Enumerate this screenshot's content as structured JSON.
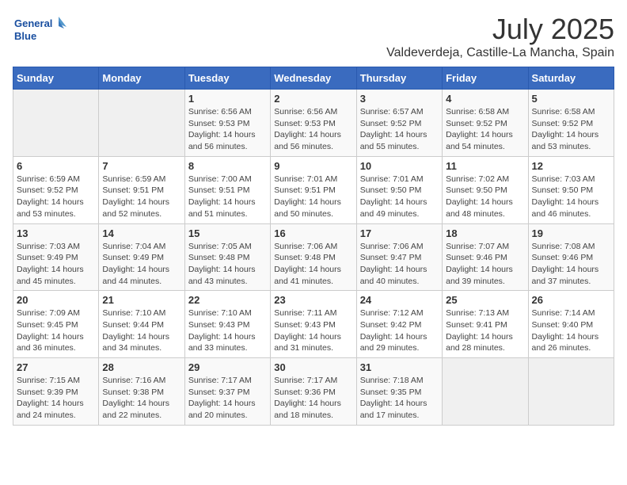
{
  "header": {
    "logo_line1": "General",
    "logo_line2": "Blue",
    "month": "July 2025",
    "location": "Valdeverdeja, Castille-La Mancha, Spain"
  },
  "weekdays": [
    "Sunday",
    "Monday",
    "Tuesday",
    "Wednesday",
    "Thursday",
    "Friday",
    "Saturday"
  ],
  "weeks": [
    [
      {
        "day": "",
        "info": ""
      },
      {
        "day": "",
        "info": ""
      },
      {
        "day": "1",
        "info": "Sunrise: 6:56 AM\nSunset: 9:53 PM\nDaylight: 14 hours and 56 minutes."
      },
      {
        "day": "2",
        "info": "Sunrise: 6:56 AM\nSunset: 9:53 PM\nDaylight: 14 hours and 56 minutes."
      },
      {
        "day": "3",
        "info": "Sunrise: 6:57 AM\nSunset: 9:52 PM\nDaylight: 14 hours and 55 minutes."
      },
      {
        "day": "4",
        "info": "Sunrise: 6:58 AM\nSunset: 9:52 PM\nDaylight: 14 hours and 54 minutes."
      },
      {
        "day": "5",
        "info": "Sunrise: 6:58 AM\nSunset: 9:52 PM\nDaylight: 14 hours and 53 minutes."
      }
    ],
    [
      {
        "day": "6",
        "info": "Sunrise: 6:59 AM\nSunset: 9:52 PM\nDaylight: 14 hours and 53 minutes."
      },
      {
        "day": "7",
        "info": "Sunrise: 6:59 AM\nSunset: 9:51 PM\nDaylight: 14 hours and 52 minutes."
      },
      {
        "day": "8",
        "info": "Sunrise: 7:00 AM\nSunset: 9:51 PM\nDaylight: 14 hours and 51 minutes."
      },
      {
        "day": "9",
        "info": "Sunrise: 7:01 AM\nSunset: 9:51 PM\nDaylight: 14 hours and 50 minutes."
      },
      {
        "day": "10",
        "info": "Sunrise: 7:01 AM\nSunset: 9:50 PM\nDaylight: 14 hours and 49 minutes."
      },
      {
        "day": "11",
        "info": "Sunrise: 7:02 AM\nSunset: 9:50 PM\nDaylight: 14 hours and 48 minutes."
      },
      {
        "day": "12",
        "info": "Sunrise: 7:03 AM\nSunset: 9:50 PM\nDaylight: 14 hours and 46 minutes."
      }
    ],
    [
      {
        "day": "13",
        "info": "Sunrise: 7:03 AM\nSunset: 9:49 PM\nDaylight: 14 hours and 45 minutes."
      },
      {
        "day": "14",
        "info": "Sunrise: 7:04 AM\nSunset: 9:49 PM\nDaylight: 14 hours and 44 minutes."
      },
      {
        "day": "15",
        "info": "Sunrise: 7:05 AM\nSunset: 9:48 PM\nDaylight: 14 hours and 43 minutes."
      },
      {
        "day": "16",
        "info": "Sunrise: 7:06 AM\nSunset: 9:48 PM\nDaylight: 14 hours and 41 minutes."
      },
      {
        "day": "17",
        "info": "Sunrise: 7:06 AM\nSunset: 9:47 PM\nDaylight: 14 hours and 40 minutes."
      },
      {
        "day": "18",
        "info": "Sunrise: 7:07 AM\nSunset: 9:46 PM\nDaylight: 14 hours and 39 minutes."
      },
      {
        "day": "19",
        "info": "Sunrise: 7:08 AM\nSunset: 9:46 PM\nDaylight: 14 hours and 37 minutes."
      }
    ],
    [
      {
        "day": "20",
        "info": "Sunrise: 7:09 AM\nSunset: 9:45 PM\nDaylight: 14 hours and 36 minutes."
      },
      {
        "day": "21",
        "info": "Sunrise: 7:10 AM\nSunset: 9:44 PM\nDaylight: 14 hours and 34 minutes."
      },
      {
        "day": "22",
        "info": "Sunrise: 7:10 AM\nSunset: 9:43 PM\nDaylight: 14 hours and 33 minutes."
      },
      {
        "day": "23",
        "info": "Sunrise: 7:11 AM\nSunset: 9:43 PM\nDaylight: 14 hours and 31 minutes."
      },
      {
        "day": "24",
        "info": "Sunrise: 7:12 AM\nSunset: 9:42 PM\nDaylight: 14 hours and 29 minutes."
      },
      {
        "day": "25",
        "info": "Sunrise: 7:13 AM\nSunset: 9:41 PM\nDaylight: 14 hours and 28 minutes."
      },
      {
        "day": "26",
        "info": "Sunrise: 7:14 AM\nSunset: 9:40 PM\nDaylight: 14 hours and 26 minutes."
      }
    ],
    [
      {
        "day": "27",
        "info": "Sunrise: 7:15 AM\nSunset: 9:39 PM\nDaylight: 14 hours and 24 minutes."
      },
      {
        "day": "28",
        "info": "Sunrise: 7:16 AM\nSunset: 9:38 PM\nDaylight: 14 hours and 22 minutes."
      },
      {
        "day": "29",
        "info": "Sunrise: 7:17 AM\nSunset: 9:37 PM\nDaylight: 14 hours and 20 minutes."
      },
      {
        "day": "30",
        "info": "Sunrise: 7:17 AM\nSunset: 9:36 PM\nDaylight: 14 hours and 18 minutes."
      },
      {
        "day": "31",
        "info": "Sunrise: 7:18 AM\nSunset: 9:35 PM\nDaylight: 14 hours and 17 minutes."
      },
      {
        "day": "",
        "info": ""
      },
      {
        "day": "",
        "info": ""
      }
    ]
  ]
}
